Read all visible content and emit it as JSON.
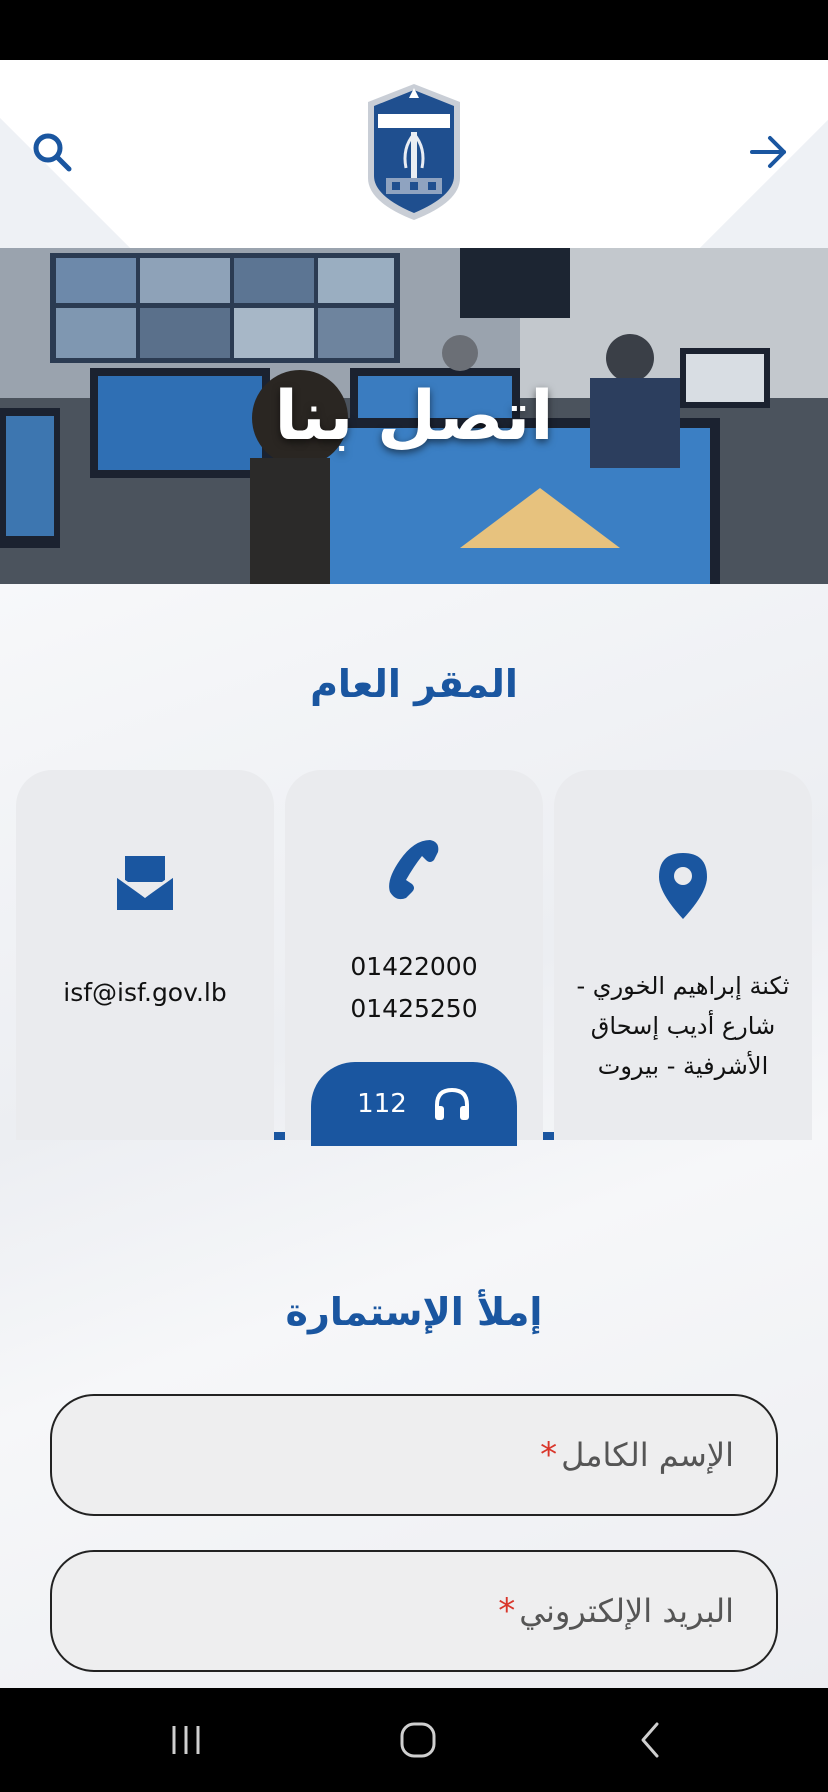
{
  "hero": {
    "title": "اتصل بنا"
  },
  "headquarters": {
    "title": "المقر العام",
    "address": {
      "line1": "ثكنة إبراهيم الخوري -",
      "line2": "شارع أديب إسحاق",
      "line3": "الأشرفية - بيروت"
    },
    "phones": [
      "01422000",
      "01425250"
    ],
    "email": "isf@isf.gov.lb",
    "hotline": "112"
  },
  "form": {
    "title": "إملأ الإستمارة",
    "fields": [
      {
        "label": "الإسم الكامل",
        "required_mark": "*"
      },
      {
        "label": "البريد الإلكتروني",
        "required_mark": "*"
      }
    ]
  },
  "colors": {
    "accent": "#1a56a0",
    "required": "#d9352a",
    "card_bg": "#eaebee"
  },
  "icons": {
    "header_left": "search-icon",
    "header_right": "arrow-right-icon",
    "address": "map-pin-icon",
    "phone": "phone-icon",
    "email": "envelope-icon",
    "hotline": "headphones-icon"
  }
}
